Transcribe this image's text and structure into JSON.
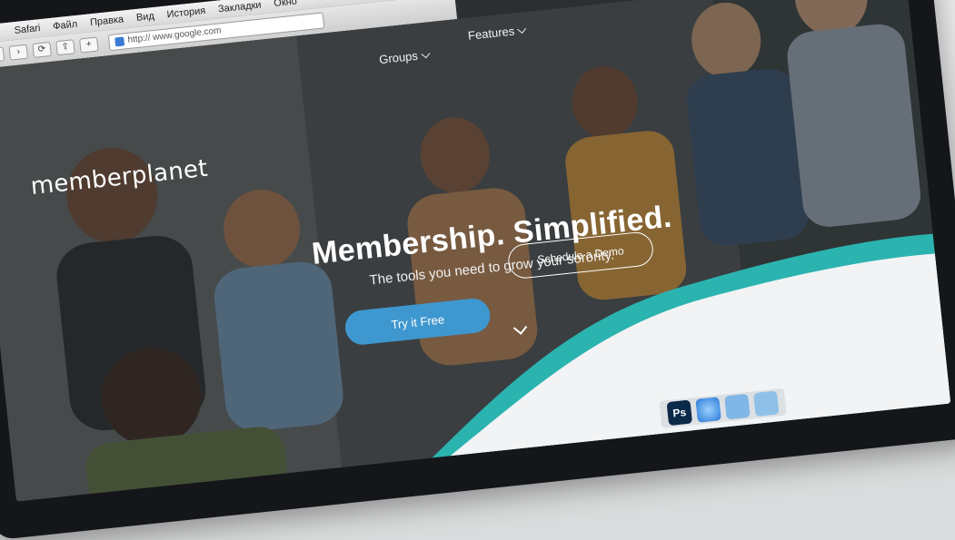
{
  "browser": {
    "menu": [
      "Safari",
      "Файл",
      "Правка",
      "Вид",
      "История",
      "Закладки",
      "Окно"
    ],
    "url": "http:// www.google.com",
    "toolbar_icons": [
      "back-icon",
      "forward-icon",
      "reload-icon",
      "share-icon",
      "add-bookmark-icon"
    ]
  },
  "site": {
    "logo": "memberplanet",
    "nav": [
      {
        "label": "Groups"
      },
      {
        "label": "Features"
      }
    ],
    "hero_title": "Membership. Simplified.",
    "hero_subtitle": "The tools you need to grow your sorority.",
    "cta_primary": "Try it Free",
    "cta_secondary": "Schedule a Demo"
  },
  "dock": {
    "items": [
      {
        "icon": "photoshop-icon",
        "label": "Ps"
      },
      {
        "icon": "safari-icon",
        "label": ""
      },
      {
        "icon": "finder-icon",
        "label": ""
      },
      {
        "icon": "folder-icon",
        "label": ""
      }
    ]
  },
  "colors": {
    "accent_blue": "#3f97cf",
    "teal_wave": "#2bb3b0",
    "bezel": "#141619"
  }
}
